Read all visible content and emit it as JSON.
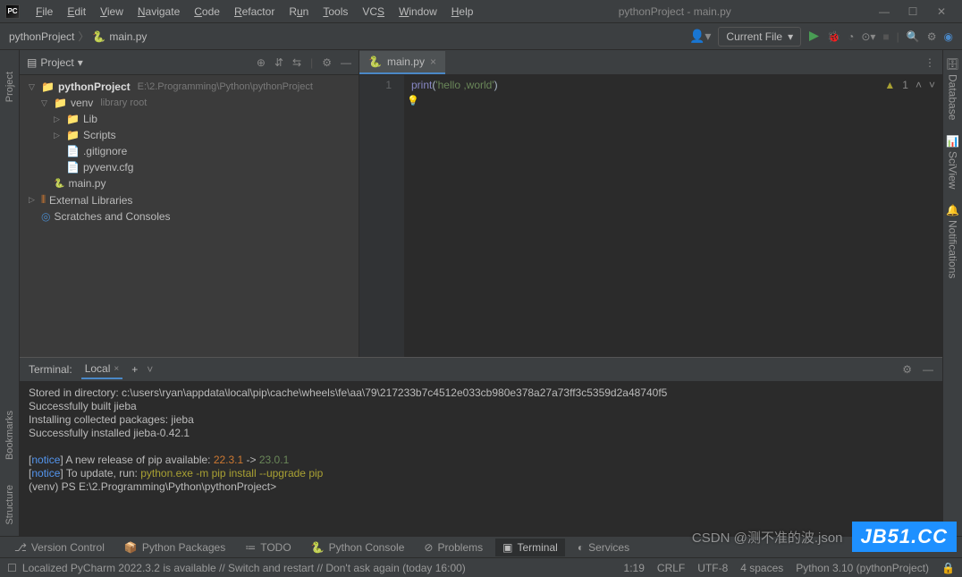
{
  "window_title": "pythonProject - main.py",
  "menu": [
    "File",
    "Edit",
    "View",
    "Navigate",
    "Code",
    "Refactor",
    "Run",
    "Tools",
    "VCS",
    "Window",
    "Help"
  ],
  "breadcrumb": {
    "project": "pythonProject",
    "file": "main.py"
  },
  "run_config": "Current File",
  "project_panel": {
    "title": "Project",
    "root": {
      "name": "pythonProject",
      "path": "E:\\2.Programming\\Python\\pythonProject"
    },
    "venv": {
      "name": "venv",
      "hint": "library root"
    },
    "lib": "Lib",
    "scripts": "Scripts",
    "gitignore": ".gitignore",
    "pyvenv": "pyvenv.cfg",
    "mainpy": "main.py",
    "extlib": "External Libraries",
    "scratch": "Scratches and Consoles"
  },
  "editor": {
    "tab": "main.py",
    "line_no": "1",
    "code_fn": "print",
    "code_open": "(",
    "code_str": "'hello ,world'",
    "code_close": ")",
    "warn_count": "1"
  },
  "terminal": {
    "title": "Terminal:",
    "tab": "Local",
    "lines": {
      "l1": "Stored in directory: c:\\users\\ryan\\appdata\\local\\pip\\cache\\wheels\\fe\\aa\\79\\217233b7c4512e033cb980e378a27a73ff3c5359d2a48740f5",
      "l2": "Successfully built jieba",
      "l3": "Installing collected packages: jieba",
      "l4": "Successfully installed jieba-0.42.1",
      "l5a": "[",
      "l5b": "notice",
      "l5c": "] A new release of pip available: ",
      "l5d": "22.3.1",
      "l5e": " -> ",
      "l5f": "23.0.1",
      "l6a": "[",
      "l6b": "notice",
      "l6c": "] To update, run: ",
      "l6d": "python.exe -m pip install --upgrade pip",
      "l7": "(venv) PS E:\\2.Programming\\Python\\pythonProject>"
    }
  },
  "bottom_tabs": {
    "vc": "Version Control",
    "pp": "Python Packages",
    "todo": "TODO",
    "pc": "Python Console",
    "prob": "Problems",
    "term": "Terminal",
    "svc": "Services"
  },
  "status": {
    "msg": "Localized PyCharm 2022.3.2 is available // Switch and restart // Don't ask again (today 16:00)",
    "pos": "1:19",
    "eol": "CRLF",
    "enc": "UTF-8",
    "indent": "4 spaces",
    "python": "Python 3.10 (pythonProject)"
  },
  "right_rail": {
    "db": "Database",
    "sci": "SciView",
    "notif": "Notifications"
  },
  "left_rail": {
    "project": "Project",
    "bookmarks": "Bookmarks",
    "structure": "Structure"
  },
  "watermark": {
    "csdn": "CSDN @测不准的波.json",
    "jb": "JB51.CC"
  }
}
